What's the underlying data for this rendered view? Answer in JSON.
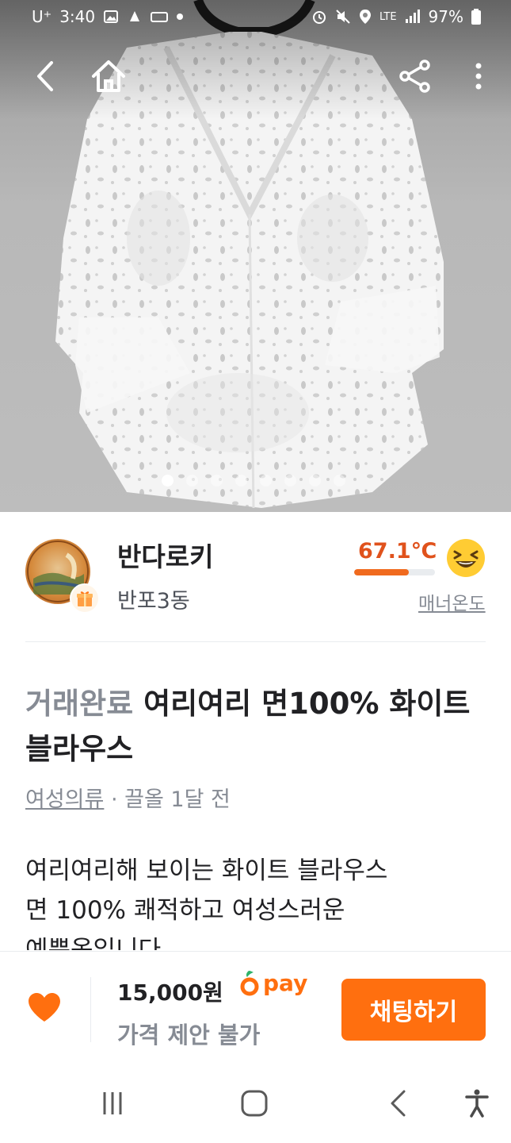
{
  "status_bar": {
    "carrier": "U⁺",
    "time": "3:40",
    "network": "LTE",
    "battery": "97%"
  },
  "gallery": {
    "image_count": 8,
    "active_index": 0
  },
  "seller": {
    "name": "반다로키",
    "location": "반포3동",
    "temperature": "67.1℃",
    "temperature_level": 0.68,
    "manner_label": "매너온도"
  },
  "post": {
    "status": "거래완료",
    "title": "여리여리 면100% 화이트 블라우스",
    "category": "여성의류",
    "separator": "·",
    "bumped": "끌올 1달 전",
    "description": "여리여리해 보이는 화이트 블라우스\n면 100% 쾌적하고 여성스러운\n예쁜옷입니다"
  },
  "bottom_bar": {
    "price": "15,000원",
    "pay_label": "pay",
    "negotiation": "가격 제안 불가",
    "chat_button": "채팅하기"
  },
  "colors": {
    "brand": "#ff6f0f",
    "temperature": "#e0521c",
    "muted": "#868b94"
  }
}
